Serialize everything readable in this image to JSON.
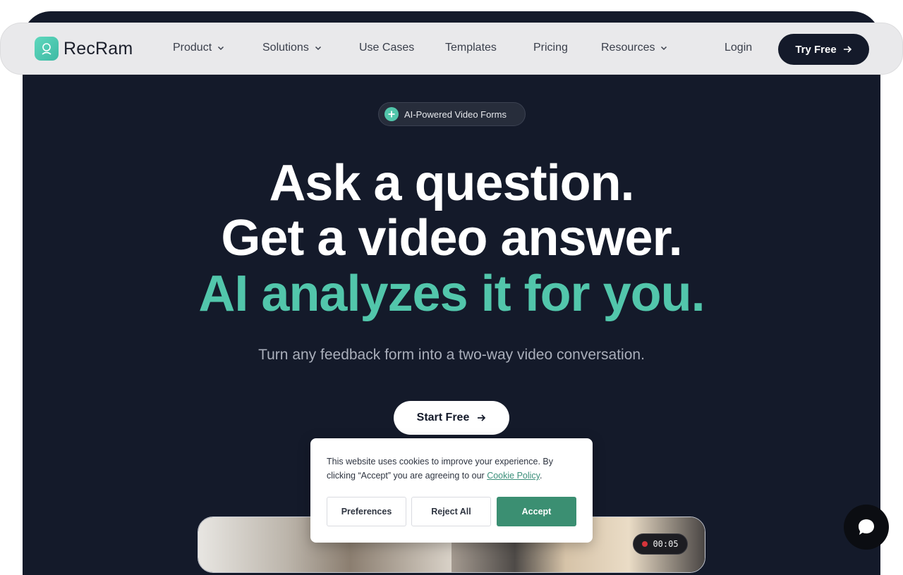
{
  "brand": {
    "name": "RecRam",
    "accent": "#52c6ab",
    "dark": "#141a2a"
  },
  "nav": {
    "items": [
      {
        "label": "Product",
        "has_dropdown": true
      },
      {
        "label": "Solutions",
        "has_dropdown": true
      },
      {
        "label": "Use Cases",
        "has_dropdown": false
      },
      {
        "label": "Templates",
        "has_dropdown": false
      },
      {
        "label": "Pricing",
        "has_dropdown": false
      },
      {
        "label": "Resources",
        "has_dropdown": true
      }
    ],
    "login_label": "Login",
    "cta_label": "Try Free"
  },
  "hero": {
    "badge": "AI-Powered Video Forms",
    "headline_line1": "Ask a question.",
    "headline_line2": "Get a video answer.",
    "headline_line3": "AI analyzes it for you.",
    "subtitle": "Turn any feedback form into a two-way video conversation.",
    "cta_label": "Start Free"
  },
  "video_preview": {
    "timer": "00:05"
  },
  "cookie_banner": {
    "text": "This website uses cookies to improve your experience. By clicking “Accept” you are agreeing to our ",
    "link_text": "Cookie Policy",
    "text_end": ".",
    "preferences_label": "Preferences",
    "reject_label": "Reject All",
    "accept_label": "Accept"
  },
  "icons": {
    "logo": "recram-logo-icon",
    "badge": "sparkle-icon",
    "arrow": "arrow-right-icon",
    "chevron": "chevron-down-icon",
    "chat": "chat-bubble-icon",
    "recording": "recording-dot-icon"
  }
}
